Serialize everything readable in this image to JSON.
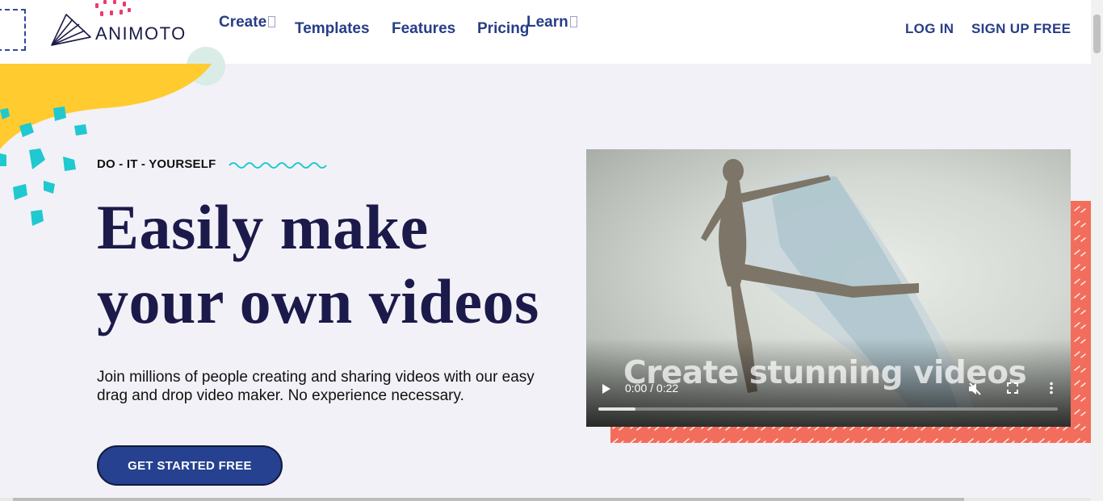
{
  "header": {
    "logo_text": "ANIMOTO",
    "nav": [
      {
        "label": "Create",
        "has_dropdown": true
      },
      {
        "label": "Templates",
        "has_dropdown": false
      },
      {
        "label": "Features",
        "has_dropdown": false
      },
      {
        "label": "Pricing",
        "has_dropdown": false
      },
      {
        "label": "Learn",
        "has_dropdown": true
      }
    ],
    "login_label": "LOG IN",
    "signup_label": "SIGN UP FREE"
  },
  "hero": {
    "eyebrow": "DO - IT - YOURSELF",
    "headline_line1": "Easily make",
    "headline_line2": "your own videos",
    "subtext": "Join millions of people creating and sharing videos with our easy drag and drop video maker. No experience necessary.",
    "cta_label": "GET STARTED FREE"
  },
  "video": {
    "caption": "Create stunning videos",
    "time": "0:00 / 0:22",
    "progress": 0.08,
    "muted": true
  },
  "colors": {
    "navy": "#1b1a4a",
    "nav_blue": "#273d87",
    "cta_blue": "#25418f",
    "yellow": "#ffcb2f",
    "teal": "#1fc9cf",
    "pink": "#ee3a6c",
    "coral": "#f26d5b",
    "mint": "#d9ece6"
  },
  "icons": {
    "logo": "paper-fan-logo-icon",
    "play": "play-icon",
    "mute": "volume-muted-icon",
    "fullscreen": "fullscreen-icon",
    "more": "more-vertical-icon"
  }
}
